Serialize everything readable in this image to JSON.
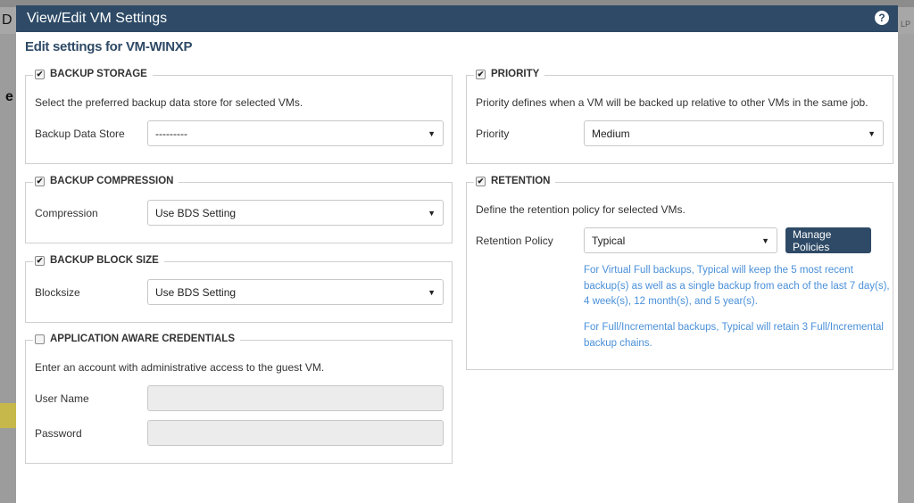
{
  "background": {
    "left_letter": "D",
    "right_text": "LP",
    "left_icon": "e"
  },
  "modal": {
    "title": "View/Edit VM Settings",
    "help_icon": "?",
    "subtitle": "Edit settings for VM-WINXP"
  },
  "backup_storage": {
    "legend": "BACKUP STORAGE",
    "checked": true,
    "description": "Select the preferred backup data store for selected VMs.",
    "field_label": "Backup Data Store",
    "selected": "---------"
  },
  "backup_compression": {
    "legend": "BACKUP COMPRESSION",
    "checked": true,
    "field_label": "Compression",
    "selected": "Use BDS Setting"
  },
  "backup_block_size": {
    "legend": "BACKUP BLOCK SIZE",
    "checked": true,
    "field_label": "Blocksize",
    "selected": "Use BDS Setting"
  },
  "app_aware": {
    "legend": "APPLICATION AWARE CREDENTIALS",
    "checked": false,
    "description": "Enter an account with administrative access to the guest VM.",
    "username_label": "User Name",
    "password_label": "Password",
    "username_value": "",
    "password_value": ""
  },
  "priority": {
    "legend": "PRIORITY",
    "checked": true,
    "description": "Priority defines when a VM will be backed up relative to other VMs in the same job.",
    "field_label": "Priority",
    "selected": "Medium"
  },
  "retention": {
    "legend": "RETENTION",
    "checked": true,
    "description": "Define the retention policy for selected VMs.",
    "field_label": "Retention Policy",
    "selected": "Typical",
    "manage_button": "Manage Policies",
    "note1_line1": "For Virtual Full backups, Typical will keep the 5 most recent",
    "note1_line2": "backup(s) as well as a single backup from each of the last 7 day(s),",
    "note1_line3": "4 week(s), 12 month(s), and 5 year(s).",
    "note2_line1": "For Full/Incremental backups, Typical will retain 3 Full/Incremental",
    "note2_line2": "backup chains."
  },
  "colors": {
    "header": "#2e4a66",
    "note": "#4a90d9"
  },
  "icons": {
    "checkbox_checked": "✔",
    "caret": "▼"
  }
}
